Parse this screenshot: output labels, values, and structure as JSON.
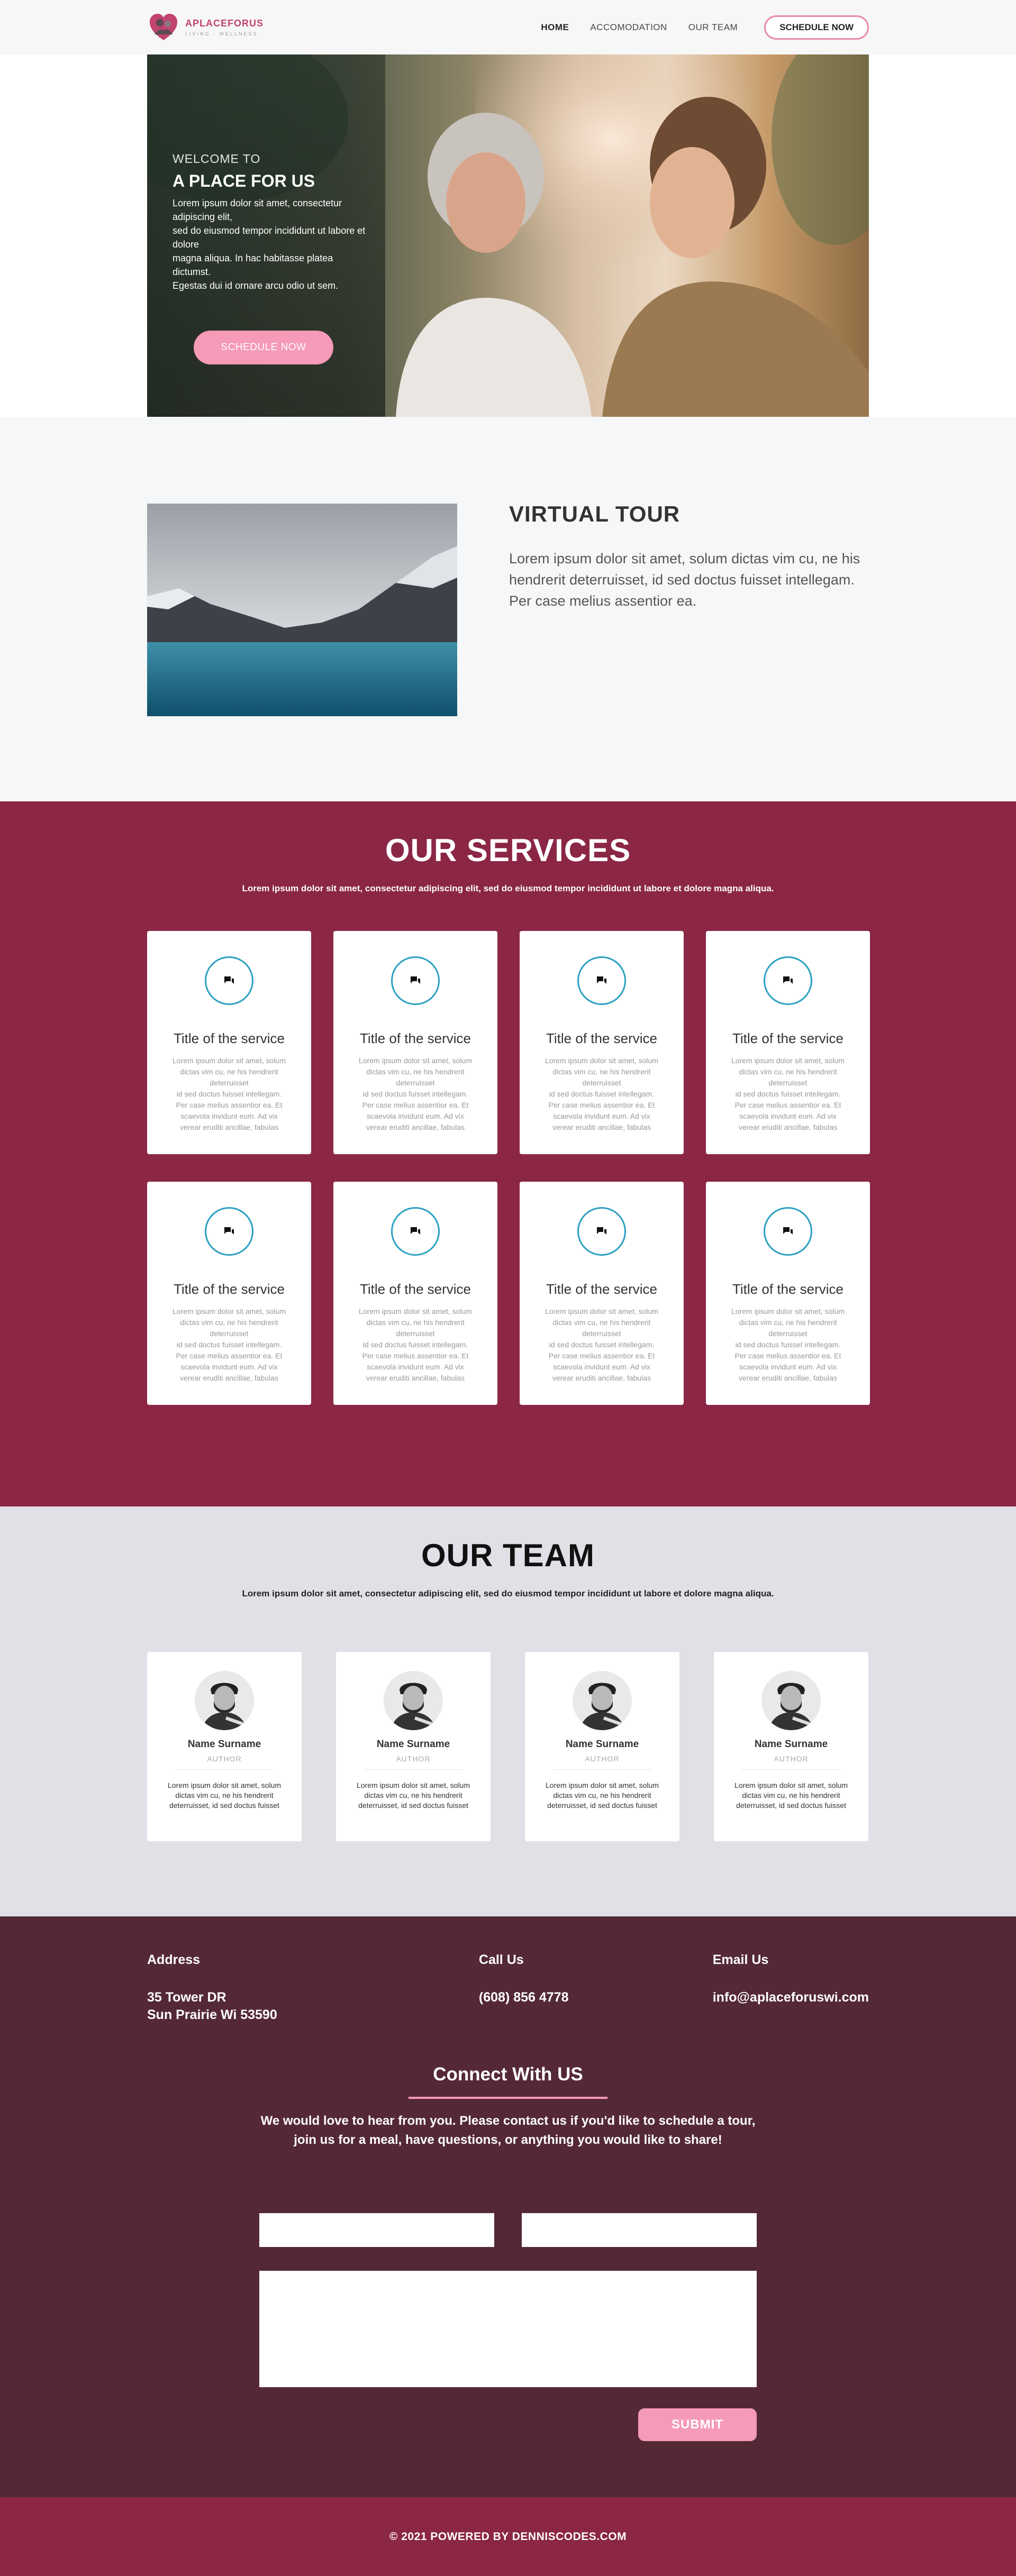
{
  "nav": {
    "logo_name": "APLACEFORUS",
    "logo_tagline": "LIVING · WELLNESS",
    "links": [
      "HOME",
      "ACCOMODATION",
      "OUR TEAM"
    ],
    "cta": "SCHEDULE NOW"
  },
  "hero": {
    "welcome": "WELCOME TO",
    "title": "A PLACE FOR  US",
    "text": "Lorem ipsum dolor sit amet, consectetur adipiscing elit,\nsed do eiusmod tempor incididunt ut labore et dolore\nmagna aliqua. In hac habitasse platea dictumst.\nEgestas dui id ornare arcu odio ut sem.",
    "button": "SCHEDULE NOW"
  },
  "tour": {
    "title": "VIRTUAL TOUR",
    "body": "Lorem ipsum dolor sit amet, solum dictas vim cu, ne his hendrerit deterruisset, id sed doctus fuisset intellegam. Per case melius assentior ea."
  },
  "services": {
    "title": "OUR SERVICES",
    "subtitle": "Lorem ipsum dolor sit amet, consectetur adipiscing elit, sed do eiusmod tempor incididunt ut labore et dolore magna aliqua.",
    "items": [
      {
        "icon": "chat-icon",
        "title": "Title of the service",
        "text": "Lorem ipsum dolor sit amet, solum\ndictas vim cu, ne his hendrerit\ndeterruisset\nid sed doctus fuisset intellegam.\nPer case melius assentior ea. Et\nscaevola invidunt eum. Ad vix\nverear eruditi ancillae, fabulas"
      },
      {
        "icon": "chat-icon",
        "title": "Title of the service",
        "text": "Lorem ipsum dolor sit amet, solum\ndictas vim cu, ne his hendrerit\ndeterruisset\nid sed doctus fuisset intellegam.\nPer case melius assentior ea. Et\nscaevola invidunt eum. Ad vix\nverear eruditi ancillae, fabulas"
      },
      {
        "icon": "chat-icon",
        "title": "Title of the service",
        "text": "Lorem ipsum dolor sit amet, solum\ndictas vim cu, ne his hendrerit\ndeterruisset\nid sed doctus fuisset intellegam.\nPer case melius assentior ea. Et\nscaevola invidunt eum. Ad vix\nverear eruditi ancillae, fabulas"
      },
      {
        "icon": "chat-icon",
        "title": "Title of the service",
        "text": "Lorem ipsum dolor sit amet, solum\ndictas vim cu, ne his hendrerit\ndeterruisset\nid sed doctus fuisset intellegam.\nPer case melius assentior ea. Et\nscaevola invidunt eum. Ad vix\nverear eruditi ancillae, fabulas"
      },
      {
        "icon": "chat-icon",
        "title": "Title of the service",
        "text": "Lorem ipsum dolor sit amet, solum\ndictas vim cu, ne his hendrerit\ndeterruisset\nid sed doctus fuisset intellegam.\nPer case melius assentior ea. Et\nscaevola invidunt eum. Ad vix\nverear eruditi ancillae, fabulas"
      },
      {
        "icon": "chat-icon",
        "title": "Title of the service",
        "text": "Lorem ipsum dolor sit amet, solum\ndictas vim cu, ne his hendrerit\ndeterruisset\nid sed doctus fuisset intellegam.\nPer case melius assentior ea. Et\nscaevola invidunt eum. Ad vix\nverear eruditi ancillae, fabulas"
      },
      {
        "icon": "chat-icon",
        "title": "Title of the service",
        "text": "Lorem ipsum dolor sit amet, solum\ndictas vim cu, ne his hendrerit\ndeterruisset\nid sed doctus fuisset intellegam.\nPer case melius assentior ea. Et\nscaevola invidunt eum. Ad vix\nverear eruditi ancillae, fabulas"
      },
      {
        "icon": "chat-icon",
        "title": "Title of the service",
        "text": "Lorem ipsum dolor sit amet, solum\ndictas vim cu, ne his hendrerit\ndeterruisset\nid sed doctus fuisset intellegam.\nPer case melius assentior ea. Et\nscaevola invidunt eum. Ad vix\nverear eruditi ancillae, fabulas"
      }
    ]
  },
  "team": {
    "title": "OUR TEAM",
    "subtitle": "Lorem ipsum dolor sit amet, consectetur adipiscing elit, sed do eiusmod tempor incididunt ut labore et dolore magna aliqua.",
    "members": [
      {
        "name": "Name Surname",
        "role": "AUTHOR",
        "bio": "Lorem ipsum dolor sit amet, solum\ndictas vim cu, ne his hendrerit\ndeterruisset, id sed doctus fuisset"
      },
      {
        "name": "Name Surname",
        "role": "AUTHOR",
        "bio": "Lorem ipsum dolor sit amet, solum\ndictas vim cu, ne his hendrerit\ndeterruisset, id sed doctus fuisset"
      },
      {
        "name": "Name Surname",
        "role": "AUTHOR",
        "bio": "Lorem ipsum dolor sit amet, solum\ndictas vim cu, ne his hendrerit\ndeterruisset, id sed doctus fuisset"
      },
      {
        "name": "Name Surname",
        "role": "AUTHOR",
        "bio": "Lorem ipsum dolor sit amet, solum\ndictas vim cu, ne his hendrerit\ndeterruisset, id sed doctus fuisset"
      }
    ]
  },
  "contact": {
    "address_label": "Address",
    "address_value": "35 Tower DR\nSun Prairie Wi 53590",
    "call_label": "Call Us",
    "call_value": "(608) 856 4778",
    "email_label": "Email Us",
    "email_value": "info@aplaceforuswi.com",
    "connect_title": "Connect With US",
    "connect_text": "We would love to hear from you. Please contact us if you'd like to schedule a tour,\njoin us for a meal, have questions, or anything you would like to share!",
    "field1_placeholder": "",
    "field2_placeholder": "",
    "message_placeholder": "",
    "submit": "SUBMIT"
  },
  "footer": {
    "text": "© 2021 POWERED BY DENNISCODES.COM"
  },
  "colors": {
    "brand": "#8b2645",
    "accent": "#f59ab7",
    "contact_bg": "#542935",
    "team_bg": "#dfe1e6",
    "icon_ring": "#2aa0c1"
  }
}
